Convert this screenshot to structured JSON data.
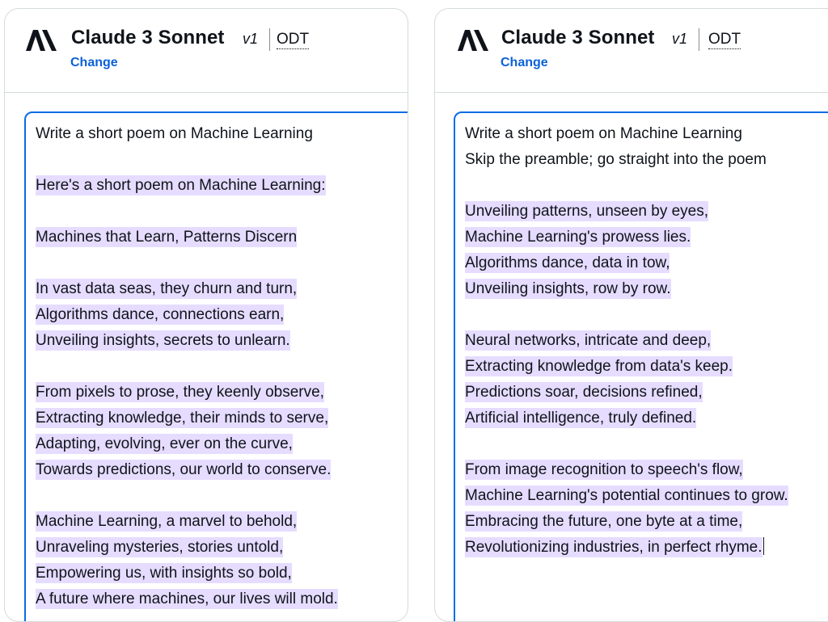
{
  "panels": [
    {
      "model_name": "Claude 3 Sonnet",
      "version": "v1",
      "odt_label": "ODT",
      "change_label": "Change",
      "prompt_lines": [
        "Write a short poem on Machine Learning"
      ],
      "response_lines": [
        "",
        "Here's a short poem on Machine Learning:",
        "",
        "Machines that Learn, Patterns Discern",
        "",
        "In vast data seas, they churn and turn,",
        "Algorithms dance, connections earn,",
        "Unveiling insights, secrets to unlearn.",
        "",
        "From pixels to prose, they keenly observe,",
        "Extracting knowledge, their minds to serve,",
        "Adapting, evolving, ever on the curve,",
        "Towards predictions, our world to conserve.",
        "",
        "Machine Learning, a marvel to behold,",
        "Unraveling mysteries, stories untold,",
        "Empowering us, with insights so bold,",
        "A future where machines, our lives will mold."
      ]
    },
    {
      "model_name": "Claude 3 Sonnet",
      "version": "v1",
      "odt_label": "ODT",
      "change_label": "Change",
      "prompt_lines": [
        "Write a short poem on Machine Learning",
        "Skip the preamble; go straight into the poem"
      ],
      "response_lines": [
        "",
        "Unveiling patterns, unseen by eyes,",
        "Machine Learning's prowess lies.",
        "Algorithms dance, data in tow,",
        "Unveiling insights, row by row.",
        "",
        "Neural networks, intricate and deep,",
        "Extracting knowledge from data's keep.",
        "Predictions soar, decisions refined,",
        "Artificial intelligence, truly defined.",
        "",
        "From image recognition to speech's flow,",
        "Machine Learning's potential continues to grow.",
        "Embracing the future, one byte at a time,",
        "Revolutionizing industries, in perfect rhyme."
      ]
    }
  ],
  "colors": {
    "highlight": "#e6dcff",
    "link": "#0b61d8",
    "focus_border": "#0b6be5",
    "text": "#0f141a"
  },
  "icons": {
    "logo": "anthropic-logo-icon"
  }
}
